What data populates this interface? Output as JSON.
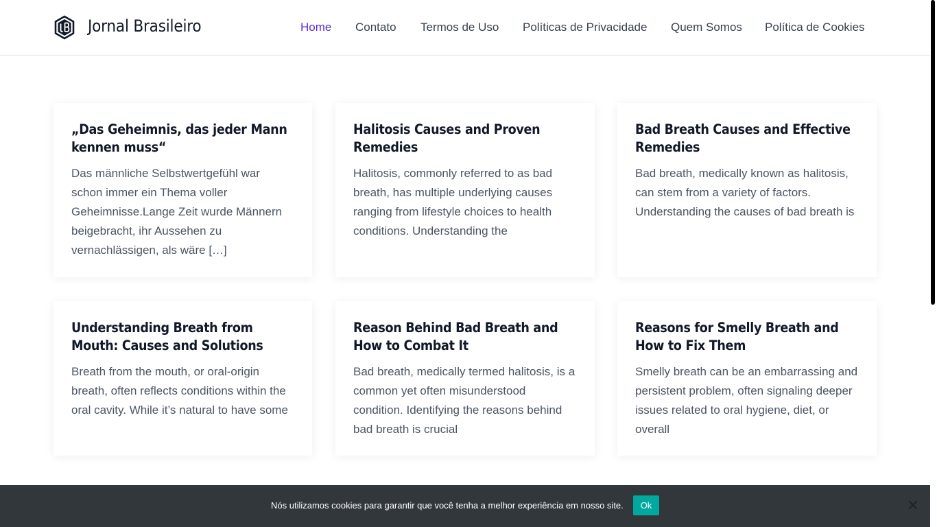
{
  "site": {
    "title": "Jornal Brasileiro",
    "logo_icon": "jb-logo-icon"
  },
  "nav": {
    "items": [
      {
        "label": "Home",
        "active": true
      },
      {
        "label": "Contato"
      },
      {
        "label": "Termos de Uso"
      },
      {
        "label": "Políticas de Privacidade"
      },
      {
        "label": "Quem Somos"
      },
      {
        "label": "Política de Cookies"
      }
    ]
  },
  "posts": [
    {
      "title": "„Das Geheimnis, das jeder Mann kennen muss“",
      "excerpt": "Das männliche Selbstwertgefühl war schon immer ein Thema voller Geheimnisse.Lange Zeit wurde Männern beigebracht, ihr Aussehen zu vernachlässigen, als wäre […]"
    },
    {
      "title": "Halitosis Causes and Proven Remedies",
      "excerpt": "Halitosis, commonly referred to as bad breath, has multiple underlying causes ranging from lifestyle choices to health conditions. Understanding the"
    },
    {
      "title": "Bad Breath Causes and Effective Remedies",
      "excerpt": "Bad breath, medically known as halitosis, can stem from a variety of factors. Understanding the causes of bad breath is"
    },
    {
      "title": "Understanding Breath from Mouth: Causes and Solutions",
      "excerpt": "Breath from the mouth, or oral-origin breath, often reflects conditions within the oral cavity. While it’s natural to have some"
    },
    {
      "title": "Reason Behind Bad Breath and How to Combat It",
      "excerpt": "Bad breath, medically termed halitosis, is a common yet often misunderstood condition. Identifying the reasons behind bad breath is crucial"
    },
    {
      "title": "Reasons for Smelly Breath and How to Fix Them",
      "excerpt": "Smelly breath can be an embarrassing and persistent problem, often signaling deeper issues related to oral hygiene, diet, or overall"
    }
  ],
  "cookie": {
    "message": "Nós utilizamos cookies para garantir que você tenha a melhor experiência em nosso site.",
    "ok_label": "Ok",
    "close_icon": "close-icon"
  },
  "colors": {
    "accent": "#5b2ad9",
    "cookie_bg": "#32373c",
    "ok_button": "#00a99d"
  }
}
